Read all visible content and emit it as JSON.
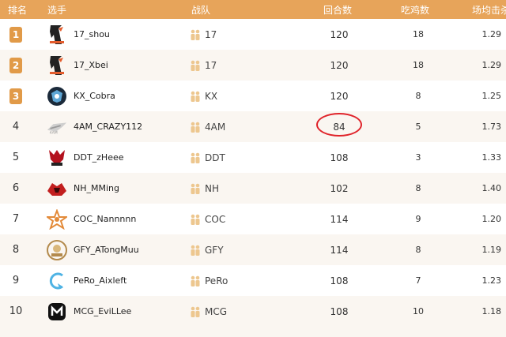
{
  "header": {
    "rank": "排名",
    "player": "选手",
    "team": "战队",
    "rounds": "回合数",
    "chicken": "吃鸡数",
    "avg": "场均击杀"
  },
  "accent_color": "#e7a45a",
  "highlight_color": "#e0232a",
  "rows": [
    {
      "rank": "1",
      "player": "17_shou",
      "team": "17",
      "rounds": "120",
      "chicken": "18",
      "avg": "1.29",
      "badge": true,
      "logo": "team-17-logo"
    },
    {
      "rank": "2",
      "player": "17_Xbei",
      "team": "17",
      "rounds": "120",
      "chicken": "18",
      "avg": "1.29",
      "badge": true,
      "logo": "team-17-logo"
    },
    {
      "rank": "3",
      "player": "KX_Cobra",
      "team": "KX",
      "rounds": "120",
      "chicken": "8",
      "avg": "1.25",
      "badge": true,
      "logo": "team-kx-logo"
    },
    {
      "rank": "4",
      "player": "4AM_CRAZY112",
      "team": "4AM",
      "rounds": "84",
      "chicken": "5",
      "avg": "1.73",
      "badge": false,
      "logo": "team-4am-logo"
    },
    {
      "rank": "5",
      "player": "DDT_zHeee",
      "team": "DDT",
      "rounds": "108",
      "chicken": "3",
      "avg": "1.33",
      "badge": false,
      "logo": "team-ddt-logo"
    },
    {
      "rank": "6",
      "player": "NH_MMing",
      "team": "NH",
      "rounds": "102",
      "chicken": "8",
      "avg": "1.40",
      "badge": false,
      "logo": "team-nh-logo"
    },
    {
      "rank": "7",
      "player": "COC_Nannnnn",
      "team": "COC",
      "rounds": "114",
      "chicken": "9",
      "avg": "1.20",
      "badge": false,
      "logo": "team-coc-logo"
    },
    {
      "rank": "8",
      "player": "GFY_ATongMuu",
      "team": "GFY",
      "rounds": "114",
      "chicken": "8",
      "avg": "1.19",
      "badge": false,
      "logo": "team-gfy-logo"
    },
    {
      "rank": "9",
      "player": "PeRo_Aixleft",
      "team": "PeRo",
      "rounds": "108",
      "chicken": "7",
      "avg": "1.23",
      "badge": false,
      "logo": "team-pero-logo"
    },
    {
      "rank": "10",
      "player": "MCG_EviLLee",
      "team": "MCG",
      "rounds": "108",
      "chicken": "10",
      "avg": "1.18",
      "badge": false,
      "logo": "team-mcg-logo"
    }
  ]
}
